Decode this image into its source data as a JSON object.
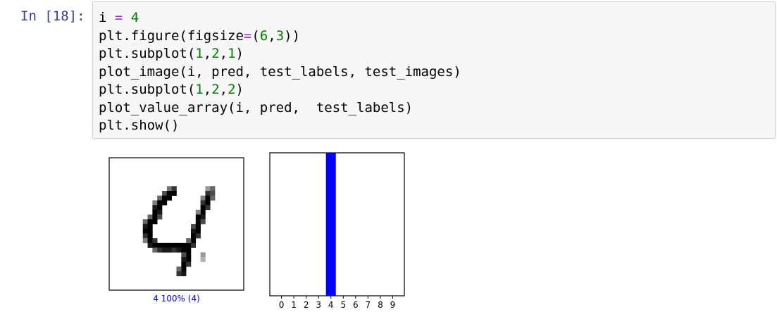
{
  "cell": {
    "prompt": "In [18]:",
    "code_lines": [
      [
        {
          "t": "i "
        },
        {
          "t": "=",
          "c": "op"
        },
        {
          "t": " "
        },
        {
          "t": "4",
          "c": "num"
        }
      ],
      [
        {
          "t": "plt.figure(figsize"
        },
        {
          "t": "=",
          "c": "op"
        },
        {
          "t": "("
        },
        {
          "t": "6",
          "c": "num"
        },
        {
          "t": ","
        },
        {
          "t": "3",
          "c": "num"
        },
        {
          "t": "))"
        }
      ],
      [
        {
          "t": "plt.subplot("
        },
        {
          "t": "1",
          "c": "num"
        },
        {
          "t": ","
        },
        {
          "t": "2",
          "c": "num"
        },
        {
          "t": ","
        },
        {
          "t": "1",
          "c": "num"
        },
        {
          "t": ")"
        }
      ],
      [
        {
          "t": "plot_image(i, pred, test_labels, test_images)"
        }
      ],
      [
        {
          "t": "plt.subplot("
        },
        {
          "t": "1",
          "c": "num"
        },
        {
          "t": ","
        },
        {
          "t": "2",
          "c": "num"
        },
        {
          "t": ","
        },
        {
          "t": "2",
          "c": "num"
        },
        {
          "t": ")"
        }
      ],
      [
        {
          "t": "plot_value_array(i, pred,  test_labels)"
        }
      ],
      [
        {
          "t": "plt.show()"
        }
      ]
    ]
  },
  "output": {
    "image_caption": "4 100% (4)",
    "caption_color": "#0000ff"
  },
  "chart_data": [
    {
      "type": "image",
      "title": "",
      "xlabel": "4 100% (4)",
      "digit_shown": "4"
    },
    {
      "type": "bar",
      "categories": [
        "0",
        "1",
        "2",
        "3",
        "4",
        "5",
        "6",
        "7",
        "8",
        "9"
      ],
      "values": [
        0,
        0,
        0,
        0,
        1,
        0,
        0,
        0,
        0,
        0
      ],
      "ylim": [
        0,
        1
      ],
      "bar_colors": [
        "#777777",
        "#777777",
        "#777777",
        "#777777",
        "#0000ff",
        "#777777",
        "#777777",
        "#777777",
        "#777777",
        "#777777"
      ],
      "grid": false
    }
  ]
}
